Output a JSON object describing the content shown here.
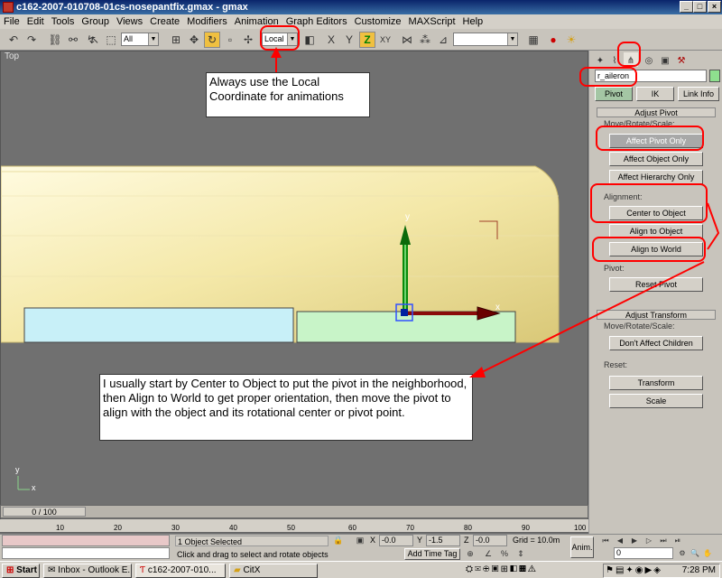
{
  "window": {
    "title": "c162-2007-010708-01cs-nosepantfix.gmax - gmax",
    "min": "_",
    "max": "□",
    "close": "×"
  },
  "menu": [
    "File",
    "Edit",
    "Tools",
    "Group",
    "Views",
    "Create",
    "Modifiers",
    "Animation",
    "Graph Editors",
    "Customize",
    "MAXScript",
    "Help"
  ],
  "toolbar": {
    "selection_filter": "All",
    "coordinate_system": "Local"
  },
  "viewport": {
    "label": "Top",
    "gizmo_y": "y",
    "gizmo_x": "x",
    "axis_y": "y",
    "axis_x": "x"
  },
  "callouts": {
    "local_note": "Always use the Local Coordinate for animations",
    "pivot_note": "I usually start by Center to Object to put the pivot in the neighborhood, then Align to World to get proper orientation, then move the pivot to align with the object and its rotational center or pivot point."
  },
  "panel": {
    "object_name": "r_aileron",
    "tabs": [
      "Pivot",
      "IK",
      "Link Info"
    ],
    "adjust_pivot_header": "Adjust Pivot",
    "move_rotate_scale_label": "Move/Rotate/Scale:",
    "affect_pivot_only": "Affect Pivot Only",
    "affect_object_only": "Affect Object Only",
    "affect_hierarchy_only": "Affect Hierarchy Only",
    "alignment_label": "Alignment:",
    "center_to_object": "Center to Object",
    "align_to_object": "Align to Object",
    "align_to_world": "Align to World",
    "pivot_label": "Pivot:",
    "reset_pivot": "Reset Pivot",
    "adjust_transform_header": "Adjust Transform",
    "move_rotate_scale_label2": "Move/Rotate/Scale:",
    "dont_affect_children": "Don't Affect Children",
    "reset_label": "Reset:",
    "transform": "Transform",
    "scale": "Scale"
  },
  "timeline": {
    "frame_display": "0 / 100",
    "ticks": [
      "10",
      "20",
      "30",
      "40",
      "50",
      "60",
      "70",
      "80",
      "90",
      "100"
    ]
  },
  "status": {
    "selection": "1 Object Selected",
    "prompt": "Click and drag to select and rotate objects",
    "x_label": "X",
    "x_value": "-0.0",
    "y_label": "Y",
    "y_value": "-1.5",
    "z_label": "Z",
    "z_value": "-0.0",
    "grid": "Grid = 10.0m",
    "add_time_tag": "Add Time Tag",
    "anim": "Anim.",
    "frame": "0"
  },
  "taskbar": {
    "start": "Start",
    "items": [
      "Inbox - Outlook E...",
      "c162-2007-010...",
      "CitX"
    ],
    "clock": "7:28 PM"
  }
}
